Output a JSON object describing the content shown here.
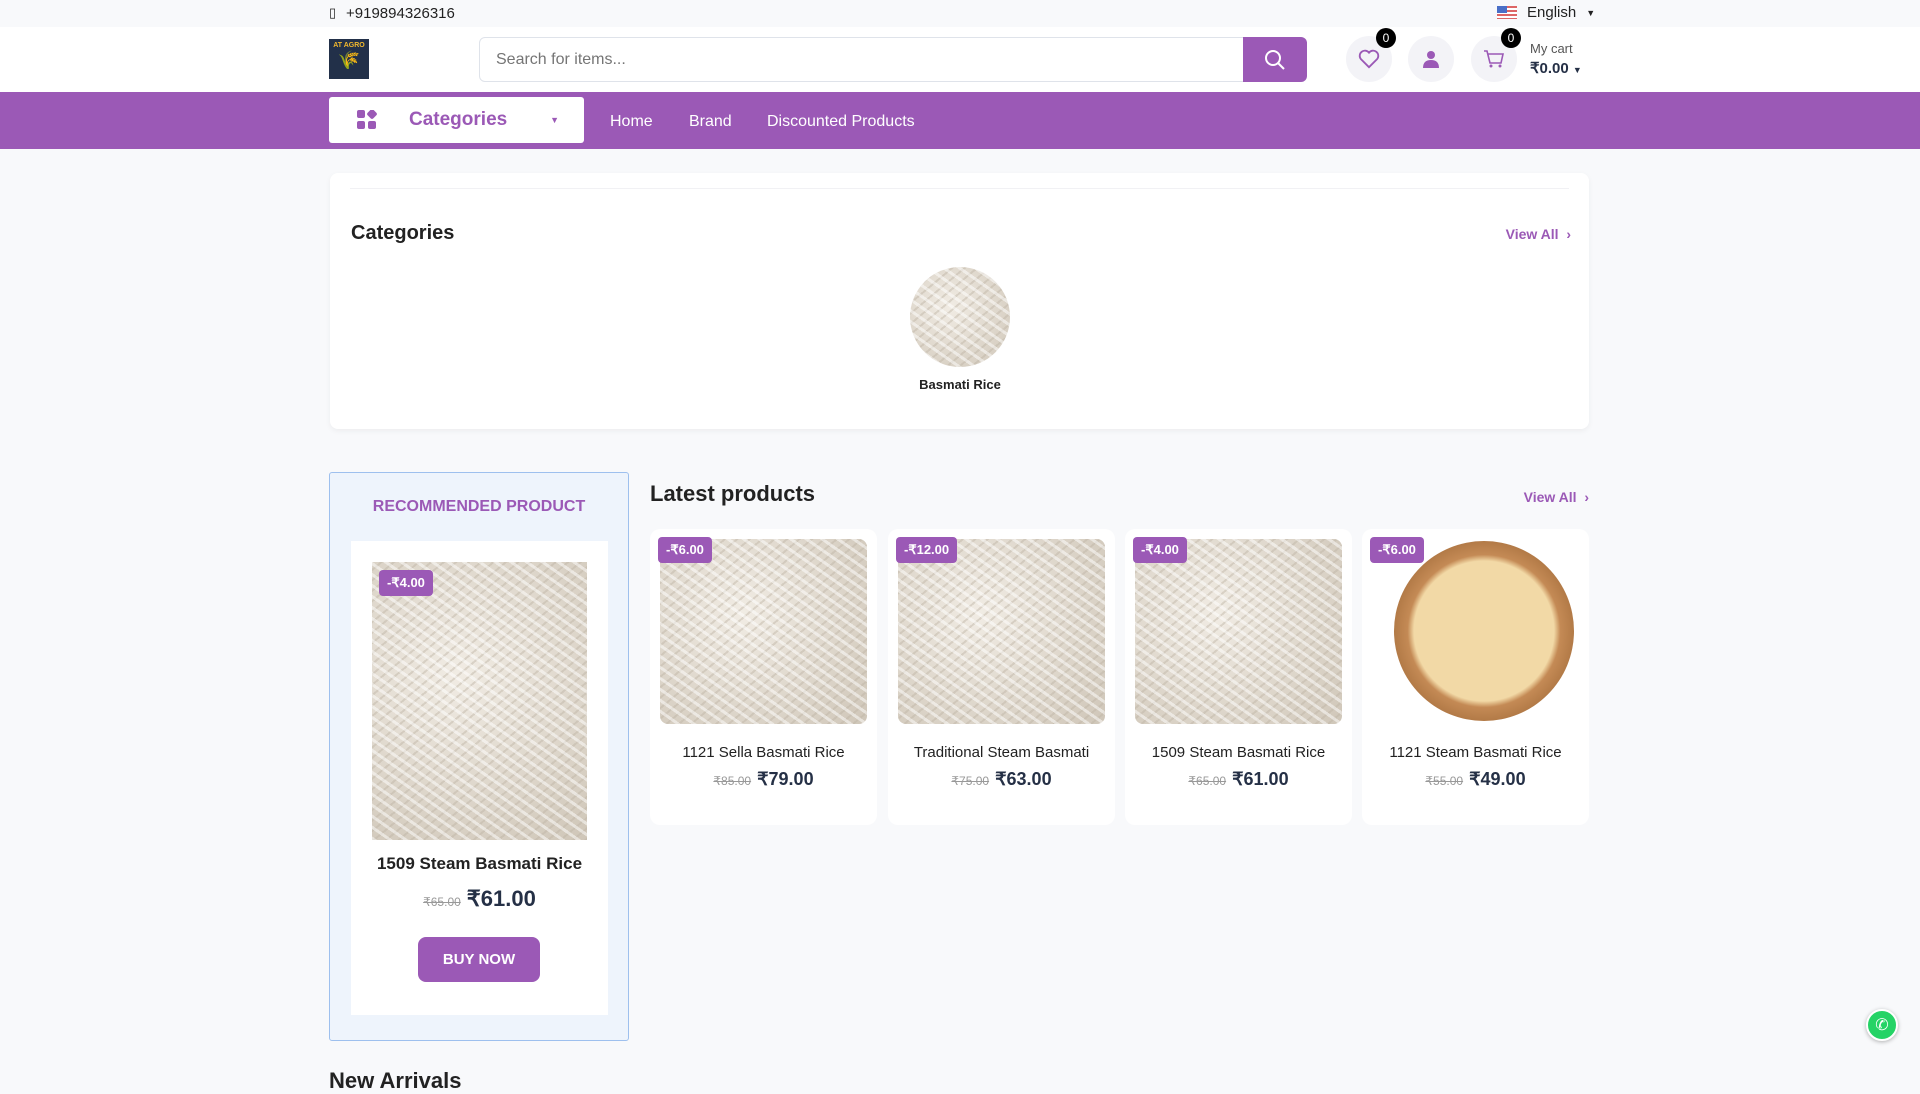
{
  "topbar": {
    "phone": "+919894326316",
    "phone_icon": "phone-icon",
    "language": "English"
  },
  "header": {
    "logo_text": "AT AGRO",
    "search_placeholder": "Search for items...",
    "wishlist_count": "0",
    "cart_count": "0",
    "cart_label": "My cart",
    "cart_total": "₹0.00"
  },
  "nav": {
    "categories": "Categories",
    "links": [
      "Home",
      "Brand",
      "Discounted Products"
    ]
  },
  "categories": {
    "title": "Categories",
    "view_all": "View All",
    "items": [
      {
        "name": "Basmati Rice"
      }
    ]
  },
  "recommended": {
    "title": "RECOMMENDED PRODUCT",
    "discount": "-₹4.00",
    "name": "1509 Steam Basmati Rice",
    "old_price": "₹65.00",
    "price": "₹61.00",
    "button": "BUY NOW"
  },
  "latest": {
    "title": "Latest products",
    "view_all": "View All",
    "products": [
      {
        "discount": "-₹6.00",
        "name": "1121 Sella Basmati Rice",
        "old_price": "₹85.00",
        "price": "₹79.00"
      },
      {
        "discount": "-₹12.00",
        "name": "Traditional Steam Basmati",
        "old_price": "₹75.00",
        "price": "₹63.00"
      },
      {
        "discount": "-₹4.00",
        "name": "1509 Steam Basmati Rice",
        "old_price": "₹65.00",
        "price": "₹61.00"
      },
      {
        "discount": "-₹6.00",
        "name": "1121 Steam Basmati Rice",
        "old_price": "₹55.00",
        "price": "₹49.00"
      }
    ]
  },
  "new_arrivals": {
    "title": "New Arrivals"
  },
  "colors": {
    "accent": "#9b59b6",
    "whatsapp": "#25d366"
  }
}
